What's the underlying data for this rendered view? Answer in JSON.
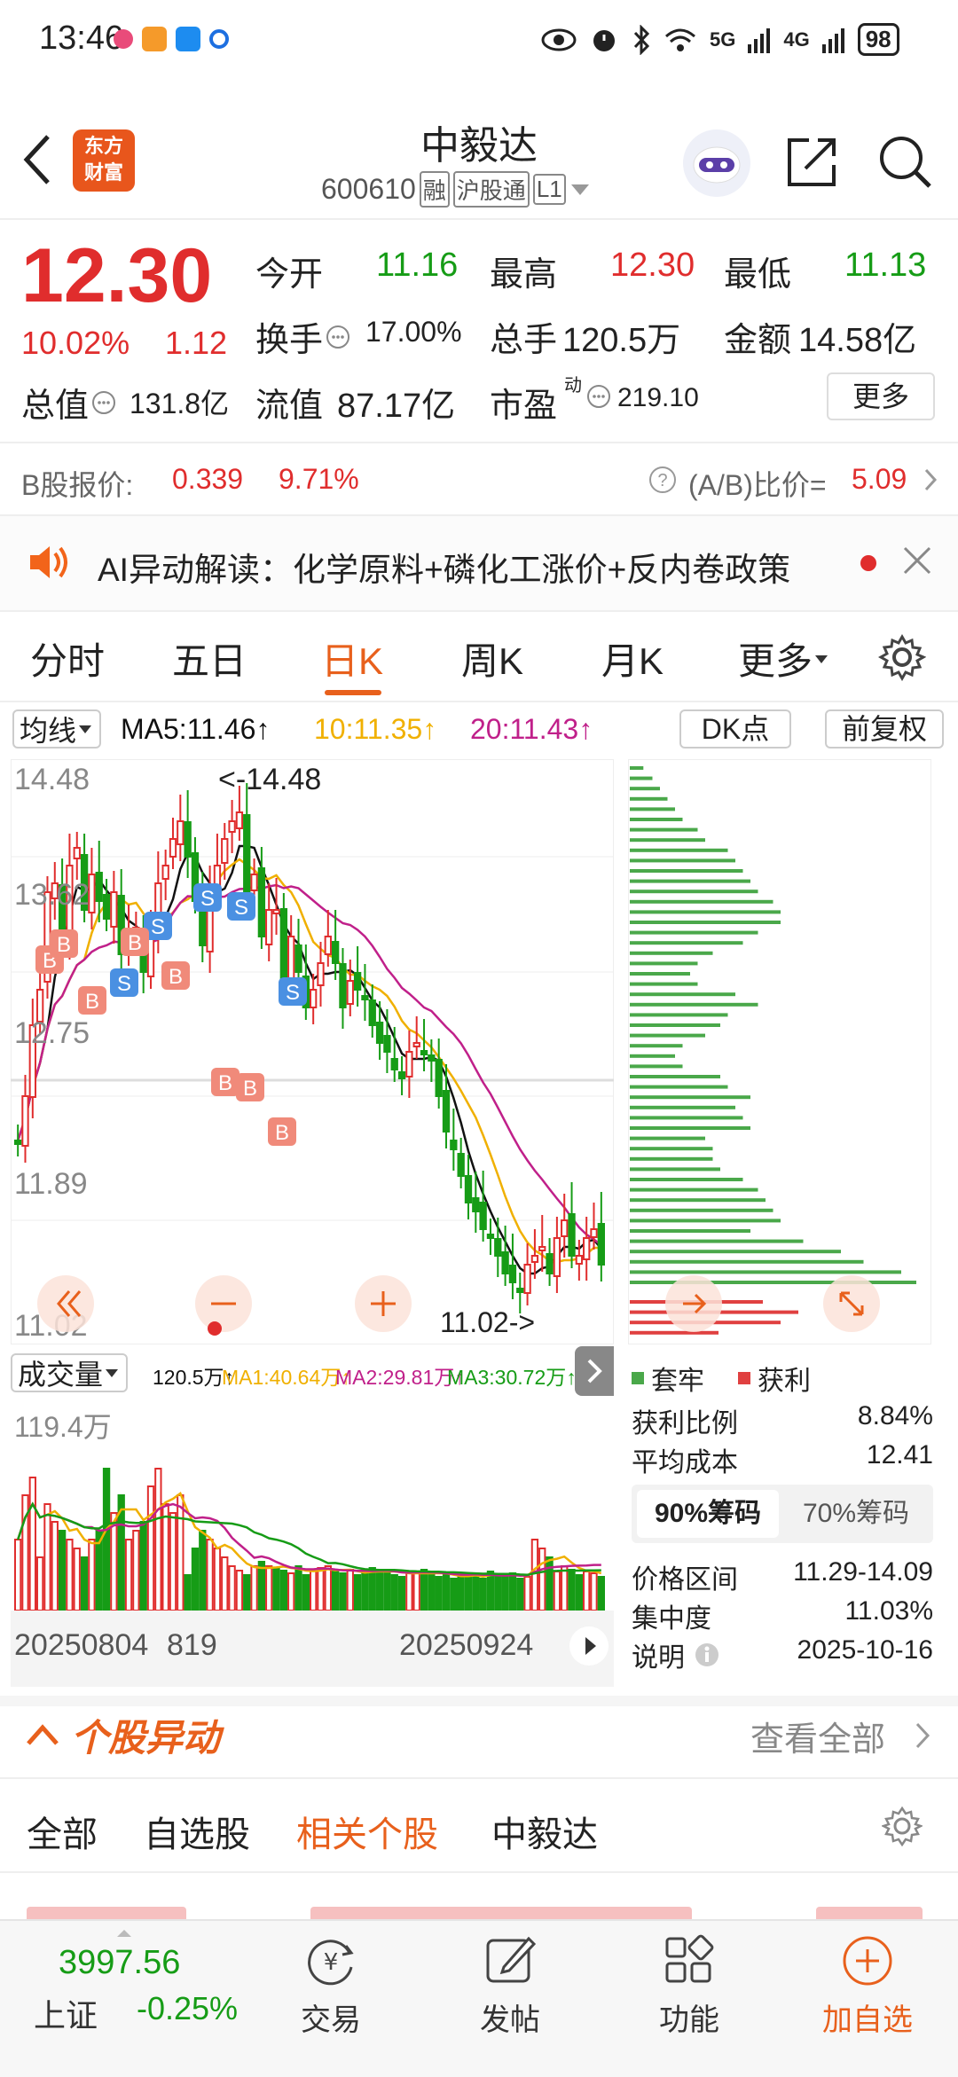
{
  "status_bar": {
    "time": "13:46",
    "battery": "98",
    "net1": "5G",
    "net2": "4G"
  },
  "header": {
    "title": "中毅达",
    "code": "600610",
    "tag1": "融",
    "tag2": "沪股通",
    "tag3": "L1",
    "logo_line1": "东方",
    "logo_line2": "财富"
  },
  "quote": {
    "price": "12.30",
    "change_pct": "10.02%",
    "change": "1.12",
    "open_label": "今开",
    "open": "11.16",
    "high_label": "最高",
    "high": "12.30",
    "low_label": "最低",
    "low": "11.13",
    "turnover_label": "换手",
    "turnover": "17.00%",
    "volume_label": "总手",
    "volume": "120.5万",
    "amount_label": "金额",
    "amount": "14.58亿",
    "mcap_label": "总值",
    "mcap": "131.8亿",
    "float_label": "流值",
    "float": "87.17亿",
    "pe_label": "市盈",
    "pe_sup": "动",
    "pe": "219.10",
    "more_button": "更多"
  },
  "bshare": {
    "label": "B股报价:",
    "price": "0.339",
    "pct": "9.71%",
    "ratio_label": "(A/B)比价=",
    "ratio": "5.09"
  },
  "ai_banner": {
    "text": "AI异动解读：化学原料+磷化工涨价+反内卷政策"
  },
  "tabs": [
    "分时",
    "五日",
    "日K",
    "周K",
    "月K",
    "更多"
  ],
  "active_tab": "日K",
  "ma_bar": {
    "ma_select": "均线",
    "ma5": "MA5:11.46↑",
    "ma10": "10:11.35↑",
    "ma20": "20:11.43↑",
    "dk": "DK点",
    "fq": "前复权"
  },
  "kline": {
    "y_labels": [
      "14.48",
      "13.62",
      "12.75",
      "11.89",
      "11.02"
    ],
    "max_label": "<-14.48",
    "min_label": "11.02->"
  },
  "vol_bar": {
    "select": "成交量",
    "vol": "120.5万↑",
    "ma1": "MA1:40.64万↑",
    "ma2": "MA2:29.81万↑",
    "ma3": "MA3:30.72万↑",
    "y_label": "119.4万",
    "date1": "20250804",
    "date1b": "819",
    "date2": "20250924"
  },
  "chips": {
    "legend_trapped": "套牢",
    "legend_profit": "获利",
    "rows": [
      {
        "label": "获利比例",
        "value": "8.84%"
      },
      {
        "label": "平均成本",
        "value": "12.41"
      }
    ],
    "tab90": "90%筹码",
    "tab70": "70%筹码",
    "rows2": [
      {
        "label": "价格区间",
        "value": "11.29-14.09"
      },
      {
        "label": "集中度",
        "value": "11.03%"
      },
      {
        "label": "说明",
        "value": "2025-10-16"
      }
    ]
  },
  "movers": {
    "title": "个股异动",
    "view_all": "查看全部"
  },
  "subtabs": [
    "全部",
    "自选股",
    "相关个股",
    "中毅达"
  ],
  "active_subtab": "相关个股",
  "bottom_nav": {
    "index_value": "3997.56",
    "index_name": "上证",
    "index_pct": "-0.25%",
    "items": [
      "交易",
      "发帖",
      "功能",
      "加自选"
    ]
  },
  "colors": {
    "up": "#e02d2d",
    "down": "#169c16",
    "accent": "#e8601c",
    "ma5": "#111111",
    "ma10": "#f0b000",
    "ma20": "#c0208a"
  }
}
